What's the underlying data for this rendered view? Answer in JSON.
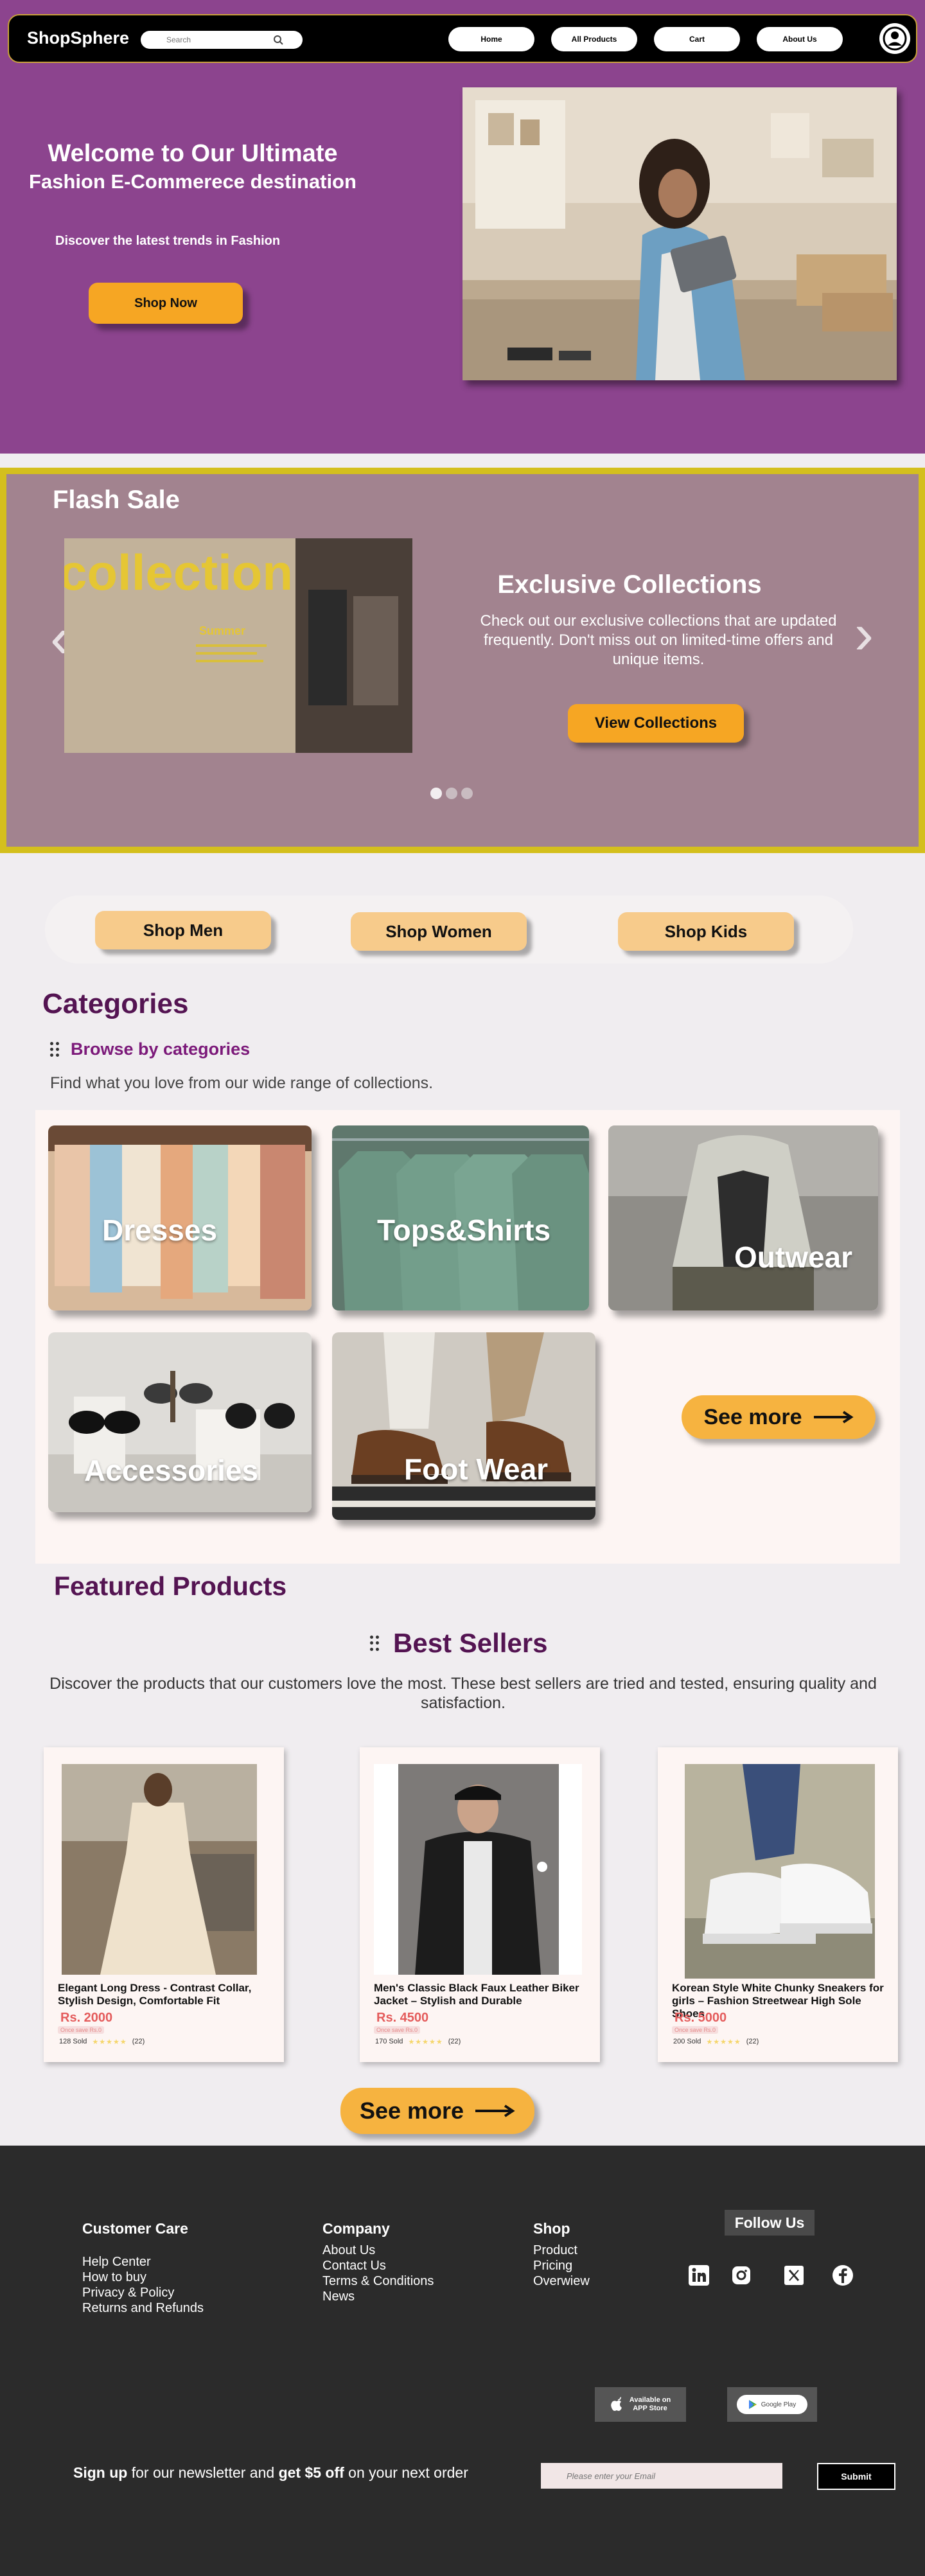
{
  "header": {
    "logo": "ShopSphere",
    "search_placeholder": "Search",
    "nav": [
      "Home",
      "All Products",
      "Cart",
      "About Us"
    ]
  },
  "hero": {
    "title_line1": "Welcome to Our Ultimate",
    "title_line2": "Fashion E-Commerece destination",
    "subtitle": "Discover the latest trends in Fashion",
    "cta": "Shop Now"
  },
  "flash_sale": {
    "title": "Flash Sale",
    "image_text": "collection",
    "image_subtext": "Summer",
    "heading": "Exclusive Collections",
    "description": "Check out our exclusive collections that are updated frequently. Don't miss out on limited-time offers and unique items.",
    "cta": "View Collections",
    "slide_count": 3,
    "active_slide": 1
  },
  "shop_buttons": [
    "Shop Men",
    "Shop Women",
    "Shop Kids"
  ],
  "categories": {
    "title": "Categories",
    "browse": "Browse by categories",
    "description": "Find what you love from our wide range of collections.",
    "items": [
      "Dresses",
      "Tops&Shirts",
      "Outwear",
      "Accessories",
      "Foot Wear"
    ],
    "see_more": "See more"
  },
  "featured": {
    "title": "Featured Products",
    "best_sellers": "Best Sellers",
    "description": "Discover the products that our customers love the most. These best sellers are tried and tested, ensuring quality and satisfaction.",
    "products": [
      {
        "name": "Elegant Long Dress - Contrast Collar, Stylish Design, Comfortable Fit",
        "price": "Rs. 2000",
        "save": "Once save Rs.0",
        "sold": "128 Sold",
        "reviews": "(22)"
      },
      {
        "name": "Men's Classic Black Faux Leather Biker Jacket – Stylish and Durable",
        "price": "Rs. 4500",
        "save": "Once save Rs.0",
        "sold": "170 Sold",
        "reviews": "(22)"
      },
      {
        "name": "Korean Style White Chunky Sneakers for girls – Fashion Streetwear High Sole Shoes",
        "price": "Rs. 5000",
        "save": "Once save Rs.0",
        "sold": "200 Sold",
        "reviews": "(22)"
      }
    ],
    "see_more": "See more"
  },
  "footer": {
    "customer_care": {
      "title": "Customer Care",
      "links": [
        "Help Center",
        "How to buy",
        "Privacy & Policy",
        "Returns and Refunds"
      ]
    },
    "company": {
      "title": "Company",
      "links": [
        "About Us",
        "Contact Us",
        "Terms & Conditions",
        "News"
      ]
    },
    "shop": {
      "title": "Shop",
      "links": [
        "Product",
        "Pricing",
        "Overwiew"
      ]
    },
    "follow_us": "Follow Us",
    "social_icons": [
      "linkedin-icon",
      "instagram-icon",
      "x-icon",
      "facebook-icon"
    ],
    "app_store": {
      "line1": "Available on",
      "line2": "APP Store"
    },
    "google_play": "Google Play",
    "newsletter": {
      "signup": "Sign up",
      "mid": " for our newsletter and ",
      "offer": "get $5 off",
      "end": " on your next order"
    },
    "email_placeholder": "Please enter your Email",
    "submit": "Submit"
  },
  "colors": {
    "brand_purple": "#8c448e",
    "accent_orange": "#f6a623",
    "heading_purple": "#541452",
    "flash_border": "#d4bf1d",
    "footer_bg": "#2b2b2b"
  }
}
